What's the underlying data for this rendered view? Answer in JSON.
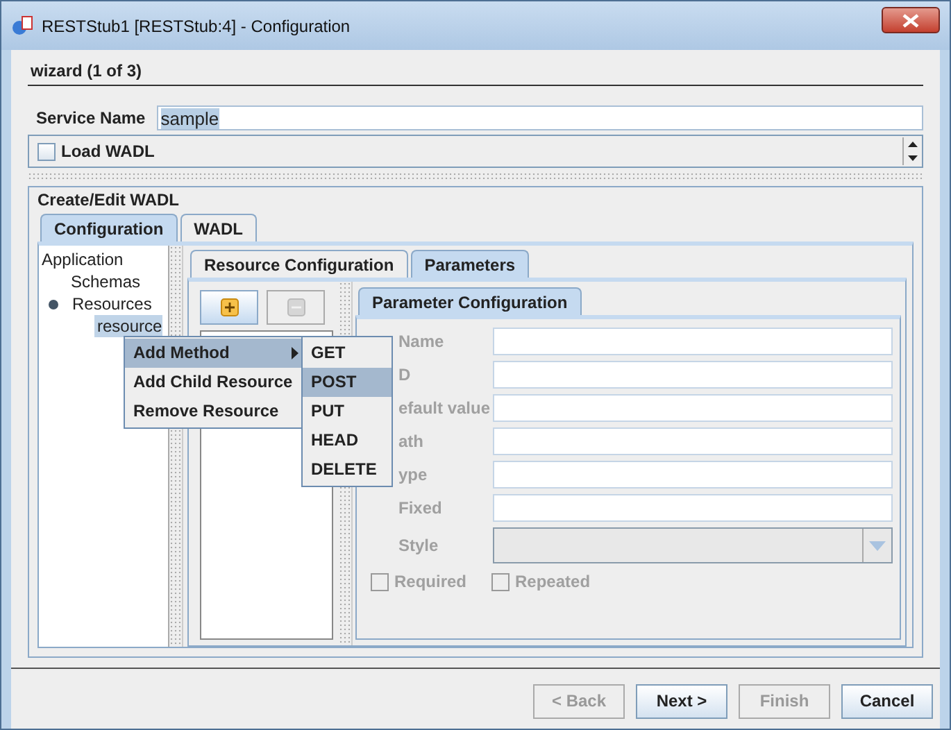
{
  "window": {
    "title": "RESTStub1 [RESTStub:4] - Configuration"
  },
  "wizard_step": "wizard (1 of 3)",
  "service_name": {
    "label": "Service Name",
    "value": "sample"
  },
  "load_wadl": {
    "label": "Load WADL",
    "checked": false
  },
  "section_title": "Create/Edit WADL",
  "tabs": [
    {
      "label": "Configuration",
      "selected": true
    },
    {
      "label": "WADL",
      "selected": false
    }
  ],
  "tree": [
    {
      "label": "Application",
      "selected": false,
      "children": [
        {
          "label": "Schemas",
          "selected": false
        },
        {
          "label": "Resources",
          "selected": false,
          "expanded": true,
          "children": [
            {
              "label": "resource",
              "selected": true
            }
          ]
        }
      ]
    }
  ],
  "inner_tabs": [
    {
      "label": "Resource Configuration",
      "selected": false
    },
    {
      "label": "Parameters",
      "selected": true
    }
  ],
  "param_tab": "Parameter Configuration",
  "param_fields": [
    {
      "label": "Name",
      "kind": "text"
    },
    {
      "label": "D",
      "kind": "text"
    },
    {
      "label": "efault value",
      "kind": "text"
    },
    {
      "label": "ath",
      "kind": "text"
    },
    {
      "label": "ype",
      "kind": "text"
    },
    {
      "label": "Fixed",
      "kind": "text"
    },
    {
      "label": "Style",
      "kind": "select"
    }
  ],
  "param_checks": [
    {
      "label": "Required",
      "checked": false
    },
    {
      "label": "Repeated",
      "checked": false
    }
  ],
  "param_disabled": true,
  "context_menu": [
    {
      "label": "Add Method",
      "submenu": true,
      "selected": true
    },
    {
      "label": "Add Child Resource",
      "submenu": false,
      "selected": false
    },
    {
      "label": "Remove  Resource",
      "submenu": false,
      "selected": false
    }
  ],
  "submenu": [
    {
      "label": "GET",
      "selected": false
    },
    {
      "label": "POST",
      "selected": true
    },
    {
      "label": "PUT",
      "selected": false
    },
    {
      "label": "HEAD",
      "selected": false
    },
    {
      "label": "DELETE",
      "selected": false
    }
  ],
  "buttons": [
    {
      "label": "< Back",
      "disabled": true
    },
    {
      "label": "Next >",
      "disabled": false
    },
    {
      "label": "Finish",
      "disabled": true
    },
    {
      "label": "Cancel",
      "disabled": false
    }
  ]
}
